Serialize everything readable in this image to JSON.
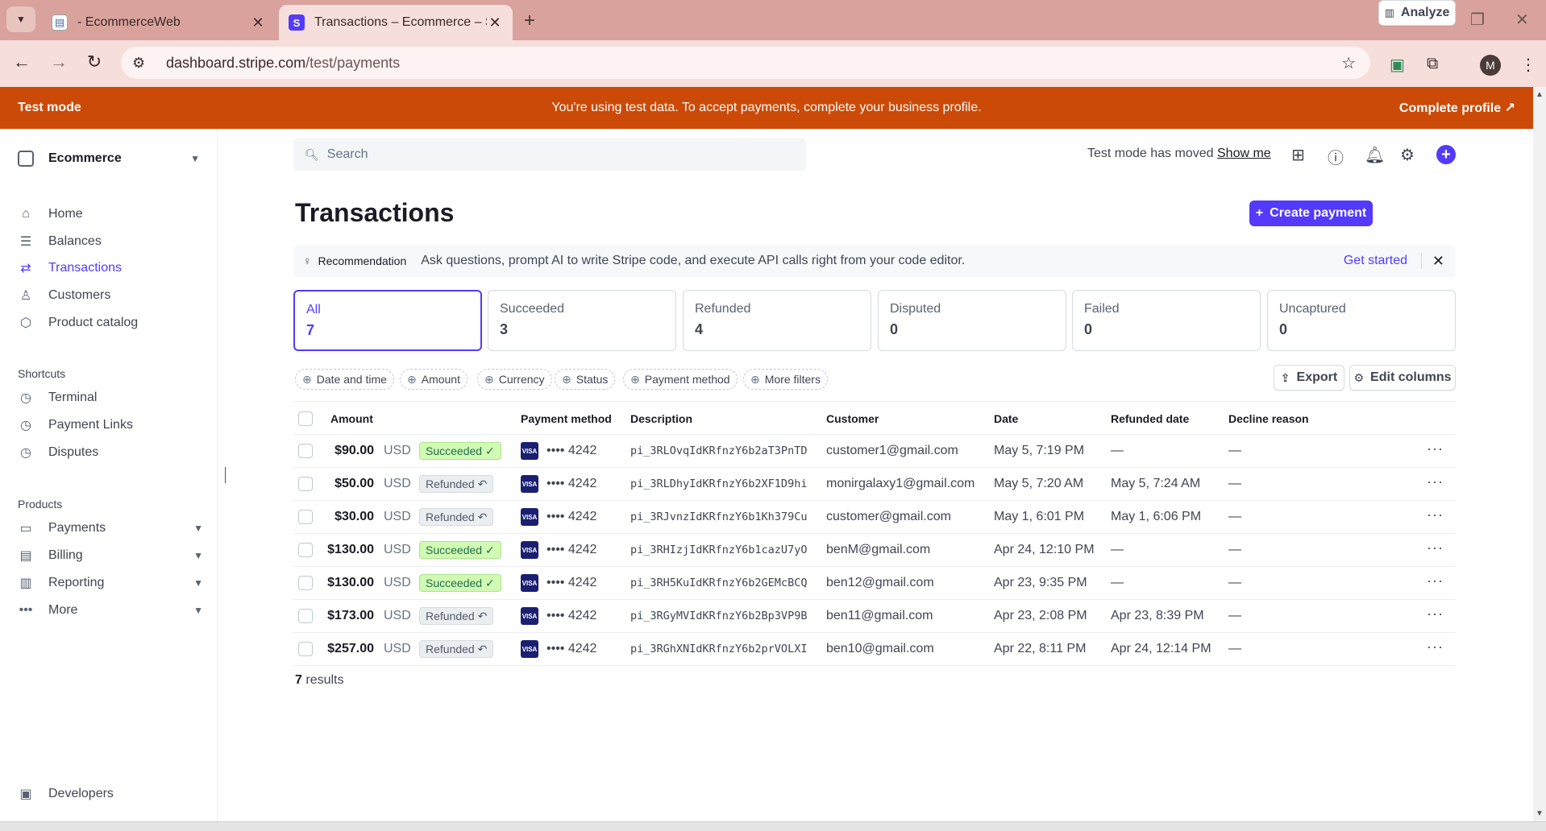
{
  "browser": {
    "tabs": [
      {
        "title": "- EcommerceWeb",
        "favicon": "doc-icon",
        "active": false
      },
      {
        "title": "Transactions – Ecommerce – Stripe",
        "favicon": "stripe-icon",
        "active": true,
        "favicon_letter": "S"
      }
    ],
    "url_host": "dashboard.stripe.com",
    "url_path": "/test/payments",
    "profile_initial": "M"
  },
  "banner": {
    "left": "Test mode",
    "center": "You're using test data. To accept payments, complete your business profile.",
    "right": "Complete profile ↗",
    "color": "#cc4a07"
  },
  "sidebar": {
    "account": "Ecommerce",
    "main_items": [
      {
        "label": "Home",
        "icon": "home-icon"
      },
      {
        "label": "Balances",
        "icon": "balances-icon"
      },
      {
        "label": "Transactions",
        "icon": "transactions-icon",
        "active": true
      },
      {
        "label": "Customers",
        "icon": "customers-icon"
      },
      {
        "label": "Product catalog",
        "icon": "product-catalog-icon"
      }
    ],
    "shortcuts_heading": "Shortcuts",
    "shortcuts": [
      {
        "label": "Terminal",
        "icon": "clock-icon"
      },
      {
        "label": "Payment Links",
        "icon": "clock-icon"
      },
      {
        "label": "Disputes",
        "icon": "clock-icon"
      }
    ],
    "products_heading": "Products",
    "products": [
      {
        "label": "Payments",
        "icon": "payments-icon"
      },
      {
        "label": "Billing",
        "icon": "billing-icon"
      },
      {
        "label": "Reporting",
        "icon": "reporting-icon"
      },
      {
        "label": "More",
        "icon": "more-icon"
      }
    ],
    "developers": "Developers"
  },
  "header": {
    "search_placeholder": "Search",
    "test_mode_note": "Test mode has moved",
    "show_me": "Show me"
  },
  "page": {
    "title": "Transactions",
    "create_payment": "Create payment",
    "analyze": "Analyze",
    "accent": "#533afd"
  },
  "recommendation": {
    "tag": "Recommendation",
    "text": "Ask questions, prompt AI to write Stripe code, and execute API calls right from your code editor.",
    "link": "Get started"
  },
  "filter_cards": [
    {
      "label": "All",
      "count": "7",
      "active": true
    },
    {
      "label": "Succeeded",
      "count": "3"
    },
    {
      "label": "Refunded",
      "count": "4"
    },
    {
      "label": "Disputed",
      "count": "0"
    },
    {
      "label": "Failed",
      "count": "0"
    },
    {
      "label": "Uncaptured",
      "count": "0"
    }
  ],
  "filter_chips": [
    "Date and time",
    "Amount",
    "Currency",
    "Status",
    "Payment method",
    "More filters"
  ],
  "toolbar": {
    "export": "Export",
    "edit_columns": "Edit columns"
  },
  "table": {
    "columns": [
      "Amount",
      "Payment method",
      "Description",
      "Customer",
      "Date",
      "Refunded date",
      "Decline reason"
    ],
    "rows": [
      {
        "amount": "$90.00",
        "currency": "USD",
        "status": "Succeeded ✓",
        "status_type": "succ",
        "card": "•••• 4242",
        "description": "pi_3RLOvqIdKRfnzY6b2aT3PnTD",
        "customer": "customer1@gmail.com",
        "date": "May 5, 7:19 PM",
        "refunded_date": "—",
        "decline": "—"
      },
      {
        "amount": "$50.00",
        "currency": "USD",
        "status": "Refunded ↶",
        "status_type": "ref",
        "card": "•••• 4242",
        "description": "pi_3RLDhyIdKRfnzY6b2XF1D9hi",
        "customer": "monirgalaxy1@gmail.com",
        "date": "May 5, 7:20 AM",
        "refunded_date": "May 5, 7:24 AM",
        "decline": "—"
      },
      {
        "amount": "$30.00",
        "currency": "USD",
        "status": "Refunded ↶",
        "status_type": "ref",
        "card": "•••• 4242",
        "description": "pi_3RJvnzIdKRfnzY6b1Kh379Cu",
        "customer": "customer@gmail.com",
        "date": "May 1, 6:01 PM",
        "refunded_date": "May 1, 6:06 PM",
        "decline": "—"
      },
      {
        "amount": "$130.00",
        "currency": "USD",
        "status": "Succeeded ✓",
        "status_type": "succ",
        "card": "•••• 4242",
        "description": "pi_3RHIzjIdKRfnzY6b1cazU7yO",
        "customer": "benM@gmail.com",
        "date": "Apr 24, 12:10 PM",
        "refunded_date": "—",
        "decline": "—"
      },
      {
        "amount": "$130.00",
        "currency": "USD",
        "status": "Succeeded ✓",
        "status_type": "succ",
        "card": "•••• 4242",
        "description": "pi_3RH5KuIdKRfnzY6b2GEMcBCQ",
        "customer": "ben12@gmail.com",
        "date": "Apr 23, 9:35 PM",
        "refunded_date": "—",
        "decline": "—"
      },
      {
        "amount": "$173.00",
        "currency": "USD",
        "status": "Refunded ↶",
        "status_type": "ref",
        "card": "•••• 4242",
        "description": "pi_3RGyMVIdKRfnzY6b2Bp3VP9B",
        "customer": "ben11@gmail.com",
        "date": "Apr 23, 2:08 PM",
        "refunded_date": "Apr 23, 8:39 PM",
        "decline": "—"
      },
      {
        "amount": "$257.00",
        "currency": "USD",
        "status": "Refunded ↶",
        "status_type": "ref",
        "card": "•••• 4242",
        "description": "pi_3RGhXNIdKRfnzY6b2prVOLXI",
        "customer": "ben10@gmail.com",
        "date": "Apr 22, 8:11 PM",
        "refunded_date": "Apr 24, 12:14 PM",
        "decline": "—"
      }
    ]
  },
  "results_count": "7",
  "results_label": "results"
}
